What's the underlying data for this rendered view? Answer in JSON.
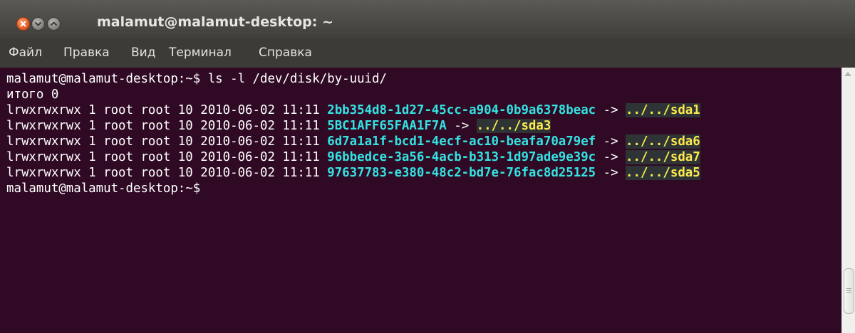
{
  "window": {
    "title": "malamut@malamut-desktop: ~"
  },
  "menu": {
    "items": [
      "Файл",
      "Правка",
      "Вид",
      "Терминал",
      "Справка"
    ]
  },
  "terminal": {
    "colors": {
      "background": "#300a24",
      "text": "#ffffff",
      "uuid": "#34e2e2",
      "link_target": "#fce94f"
    },
    "prompt_command": "malamut@malamut-desktop:~$ ls -l /dev/disk/by-uuid/",
    "total_line": "итого 0",
    "entries": [
      {
        "meta": "lrwxrwxrwx 1 root root 10 2010-06-02 11:11 ",
        "uuid": "2bb354d8-1d27-45cc-a904-0b9a6378beac",
        "arrow": " -> ",
        "target": "../../sda1"
      },
      {
        "meta": "lrwxrwxrwx 1 root root 10 2010-06-02 11:11 ",
        "uuid": "5BC1AFF65FAA1F7A",
        "arrow": " -> ",
        "target": "../../sda3"
      },
      {
        "meta": "lrwxrwxrwx 1 root root 10 2010-06-02 11:11 ",
        "uuid": "6d7a1a1f-bcd1-4ecf-ac10-beafa70a79ef",
        "arrow": " -> ",
        "target": "../../sda6"
      },
      {
        "meta": "lrwxrwxrwx 1 root root 10 2010-06-02 11:11 ",
        "uuid": "96bbedce-3a56-4acb-b313-1d97ade9e39c",
        "arrow": " -> ",
        "target": "../../sda7"
      },
      {
        "meta": "lrwxrwxrwx 1 root root 10 2010-06-02 11:11 ",
        "uuid": "97637783-e380-48c2-bd7e-76fac8d25125",
        "arrow": " -> ",
        "target": "../../sda5"
      }
    ],
    "final_prompt": "malamut@malamut-desktop:~$"
  }
}
